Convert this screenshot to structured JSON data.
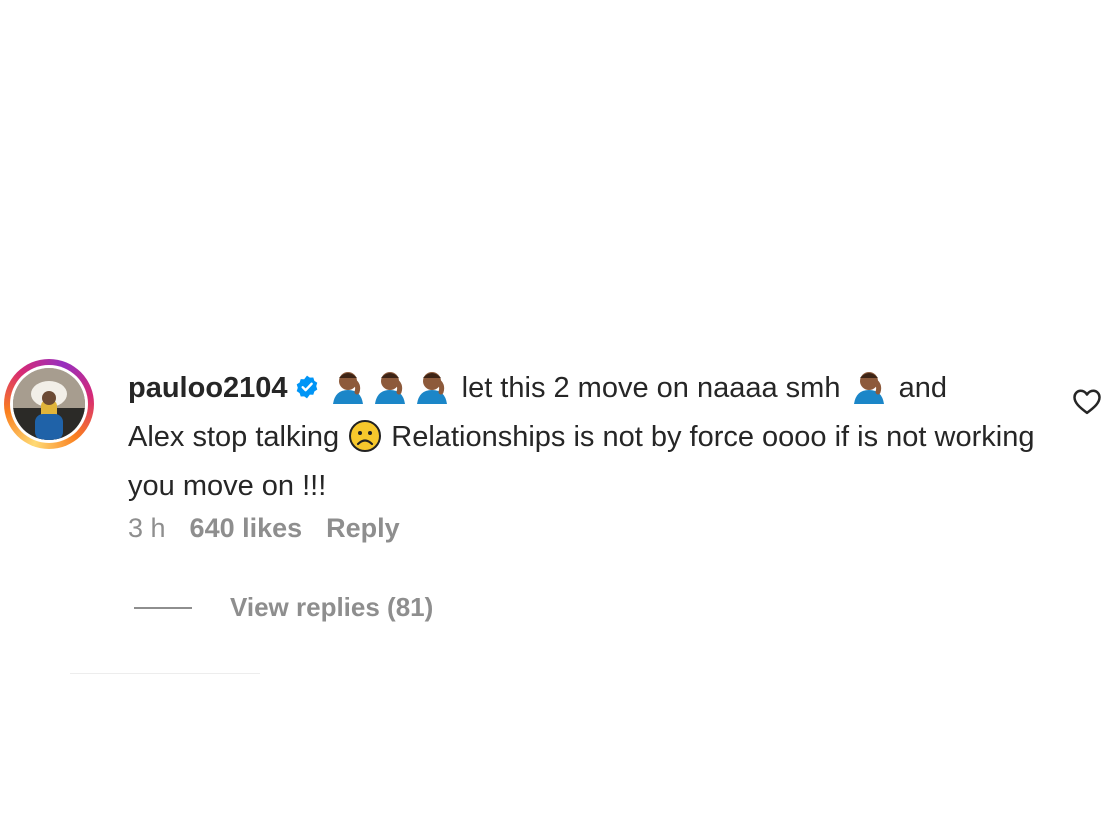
{
  "comment": {
    "username": "pauloo2104",
    "verified": true,
    "text_part1": "let this 2 move on naaaa smh",
    "text_part2": "and",
    "text_part3": "Alex stop talking",
    "text_part4": "Relationships is not by force oooo if is not working you move on !!!",
    "emoji_facepalm": "facepalm-emoji",
    "emoji_sad": "sad-face-emoji",
    "time": "3 h",
    "likes": "640 likes",
    "reply_label": "Reply",
    "view_replies_label": "View replies (81)"
  },
  "colors": {
    "text": "#262626",
    "muted": "#8e8e8e",
    "verified": "#0095f6"
  },
  "icons": {
    "like": "heart-outline-icon",
    "verified": "verified-badge-icon"
  }
}
